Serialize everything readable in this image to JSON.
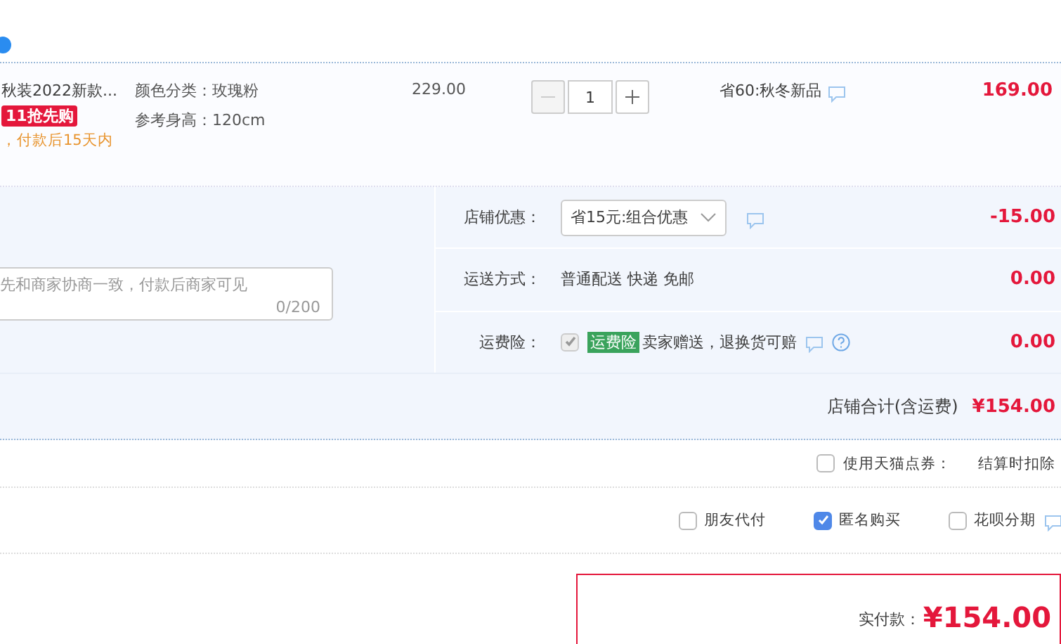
{
  "item": {
    "title": "秋装2022新款...",
    "promo_badge": "11抢先购",
    "delivery_note": "，付款后15天内",
    "specs": [
      "颜色分类：玫瑰粉",
      "参考身高：120cm"
    ],
    "unit_price": "229.00",
    "quantity": "1",
    "discount": "省60:秋冬新品",
    "subtotal": "169.00"
  },
  "order_note": {
    "placeholder": "先和商家协商一致，付款后商家可见",
    "counter": "0/200"
  },
  "shop_rows": [
    {
      "kind": "select",
      "label": "店铺优惠：",
      "value": "省15元:组合优惠",
      "amount": "-15.00"
    },
    {
      "kind": "text",
      "label": "运送方式：",
      "value": "普通配送 快递 免邮",
      "amount": "0.00"
    },
    {
      "kind": "insurance",
      "label": "运费险：",
      "checked": true,
      "disabled": true,
      "tag": "运费险",
      "value": "卖家赠送，退换货可赔",
      "amount": "0.00"
    }
  ],
  "shop_total": {
    "label": "店铺合计(含运费)",
    "amount": "¥154.00"
  },
  "coupon": {
    "label": "使用天猫点券：",
    "checked": false,
    "note": "结算时扣除"
  },
  "options": [
    {
      "label": "朋友代付",
      "checked": false
    },
    {
      "label": "匿名购买",
      "checked": true
    },
    {
      "label": "花呗分期",
      "checked": false
    }
  ],
  "payment": {
    "label": "实付款：",
    "amount": "¥154.00"
  }
}
